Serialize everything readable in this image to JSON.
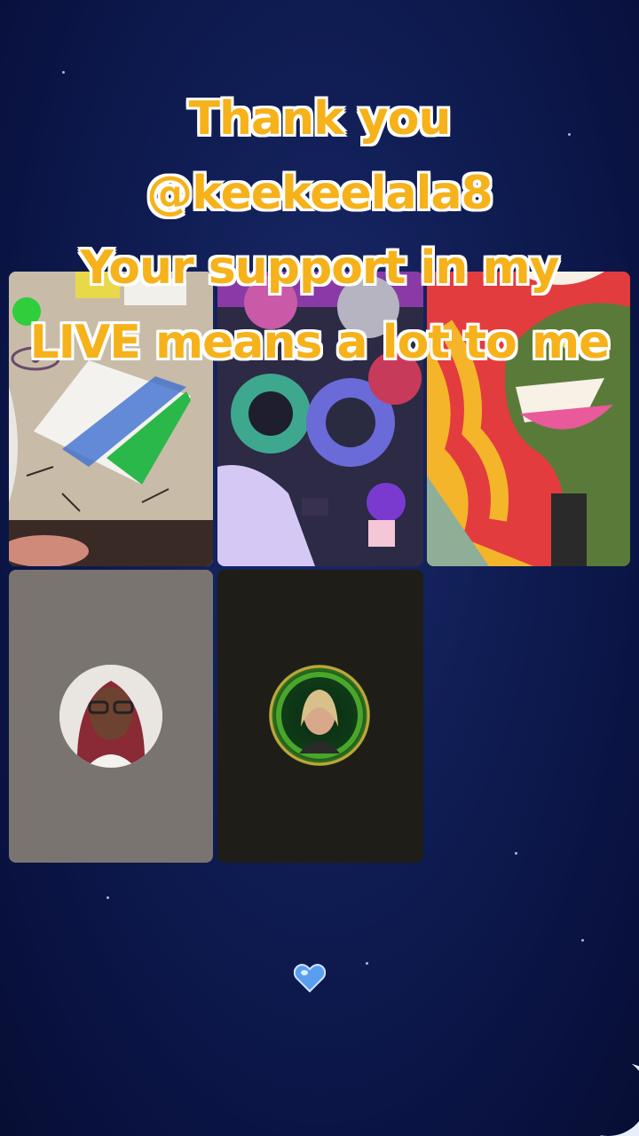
{
  "caption": {
    "line1": "Thank you",
    "line2": "@keekeelala8",
    "line3": "Your support in my",
    "line4": "LIVE means a lot to me"
  },
  "colors": {
    "caption_fill": "#f6b21a",
    "caption_outline": "#ffffff",
    "background": "#0f1c52"
  },
  "tiles": [
    {
      "id": "tile-1",
      "content": "video feed"
    },
    {
      "id": "tile-2",
      "content": "video feed"
    },
    {
      "id": "tile-3",
      "content": "video feed"
    },
    {
      "id": "tile-4",
      "content": "avatar"
    },
    {
      "id": "tile-5",
      "content": "avatar"
    }
  ],
  "icons": {
    "heart": "heart-icon",
    "moon": "moon-icon"
  }
}
